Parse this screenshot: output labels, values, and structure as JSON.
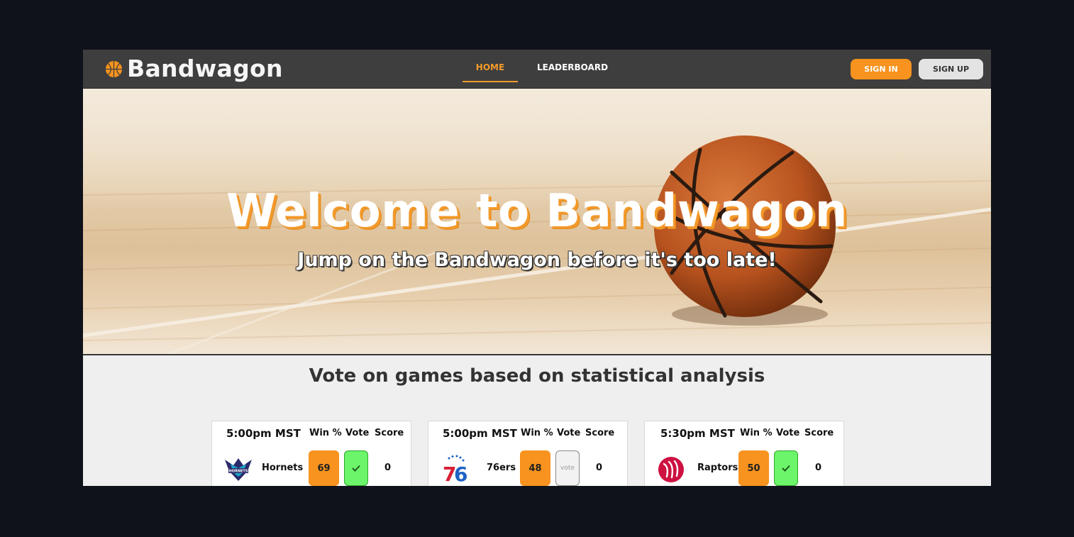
{
  "brand": {
    "name": "Bandwagon"
  },
  "nav": {
    "home": "HOME",
    "leaderboard": "LEADERBOARD"
  },
  "auth": {
    "sign_in": "SIGN IN",
    "sign_up": "SIGN UP"
  },
  "hero": {
    "title": "Welcome to Bandwagon",
    "subtitle": "Jump on the Bandwagon before it's too late!"
  },
  "section": {
    "heading": "Vote on games based on statistical analysis"
  },
  "table_headers": {
    "win": "Win %",
    "vote": "Vote",
    "score": "Score"
  },
  "games": [
    {
      "time": "5:00pm MST",
      "team": "Hornets",
      "win_pct": "69",
      "voted": true,
      "vote_label": "",
      "score": "0",
      "logo_icon": "hornets-logo-icon"
    },
    {
      "time": "5:00pm MST",
      "team": "76ers",
      "win_pct": "48",
      "voted": false,
      "vote_label": "vote",
      "score": "0",
      "logo_icon": "76ers-logo-icon"
    },
    {
      "time": "5:30pm MST",
      "team": "Raptors",
      "win_pct": "50",
      "voted": true,
      "vote_label": "",
      "score": "0",
      "logo_icon": "raptors-logo-icon"
    }
  ],
  "colors": {
    "accent": "#f7931e",
    "nav_bg": "#3e3e3e",
    "vote_green": "#6cf56a",
    "page_bg": "#0f121a"
  }
}
